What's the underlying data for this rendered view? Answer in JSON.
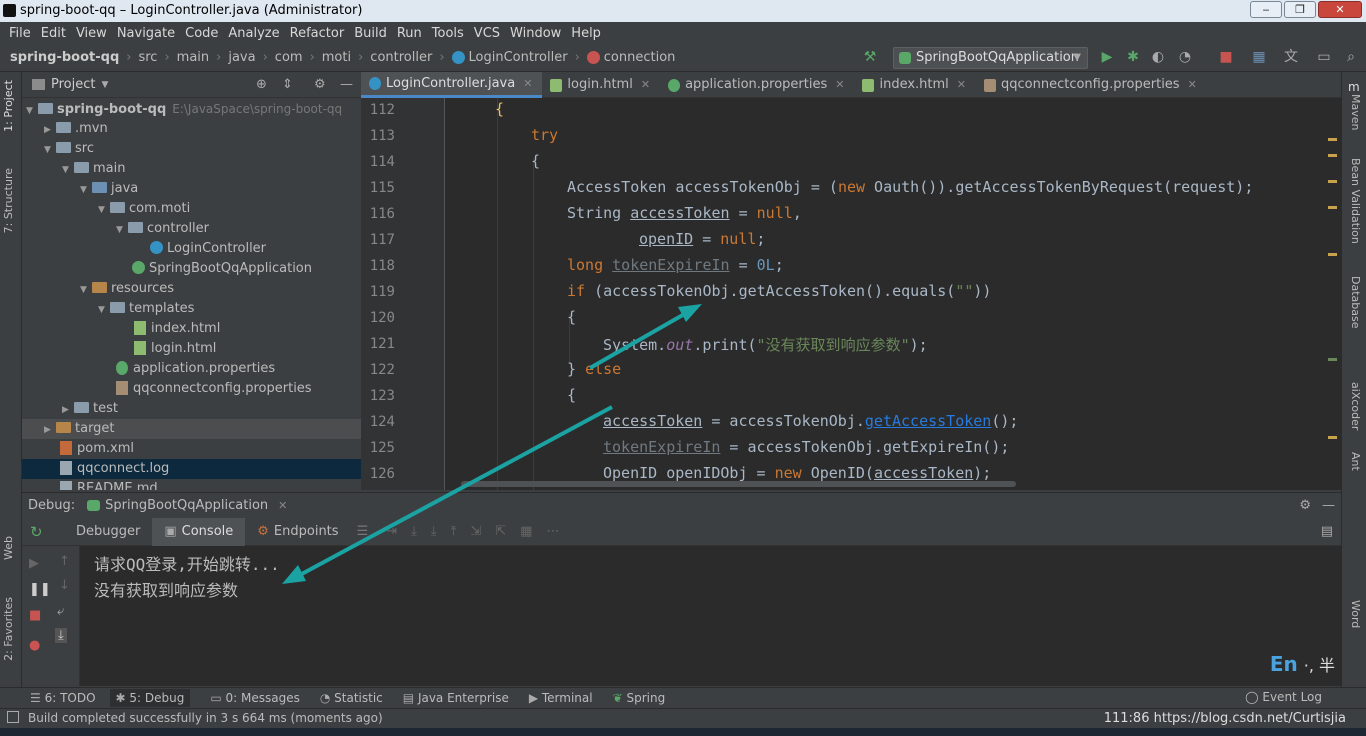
{
  "window": {
    "title": "spring-boot-qq – LoginController.java (Administrator)"
  },
  "menu": [
    "File",
    "Edit",
    "View",
    "Navigate",
    "Code",
    "Analyze",
    "Refactor",
    "Build",
    "Run",
    "Tools",
    "VCS",
    "Window",
    "Help"
  ],
  "breadcrumb": [
    "spring-boot-qq",
    "src",
    "main",
    "java",
    "com",
    "moti",
    "controller",
    "LoginController",
    "connection"
  ],
  "run_config": "SpringBootQqApplication",
  "left_tabs": {
    "project": "1: Project",
    "structure": "7: Structure",
    "web": "Web",
    "favorites": "2: Favorites"
  },
  "right_tabs": {
    "maven": "Maven",
    "bean": "Bean Validation",
    "database": "Database",
    "aixcoder": "aiXcoder",
    "ant": "Ant",
    "word": "Word"
  },
  "project": {
    "header": "Project",
    "tree": [
      {
        "label": "spring-boot-qq",
        "path": "E:\\JavaSpace\\spring-boot-qq"
      },
      {
        "label": ".mvn"
      },
      {
        "label": "src"
      },
      {
        "label": "main"
      },
      {
        "label": "java"
      },
      {
        "label": "com.moti"
      },
      {
        "label": "controller"
      },
      {
        "label": "LoginController"
      },
      {
        "label": "SpringBootQqApplication"
      },
      {
        "label": "resources"
      },
      {
        "label": "templates"
      },
      {
        "label": "index.html"
      },
      {
        "label": "login.html"
      },
      {
        "label": "application.properties"
      },
      {
        "label": "qqconnectconfig.properties"
      },
      {
        "label": "test"
      },
      {
        "label": "target"
      },
      {
        "label": "pom.xml"
      },
      {
        "label": "qqconnect.log"
      },
      {
        "label": "README.md"
      }
    ]
  },
  "editor_tabs": [
    "LoginController.java",
    "login.html",
    "application.properties",
    "index.html",
    "qqconnectconfig.properties"
  ],
  "line_numbers": [
    "112",
    "113",
    "114",
    "115",
    "116",
    "117",
    "118",
    "119",
    "120",
    "121",
    "122",
    "123",
    "124",
    "125",
    "126"
  ],
  "code": {
    "l112": "{",
    "l113": "try",
    "l114": "{",
    "l115a": "AccessToken accessTokenObj = (",
    "l115b": "new",
    "l115c": " Oauth()).getAccessTokenByRequest(request);",
    "l116a": "String ",
    "l116b": "accessToken",
    "l116c": " = ",
    "l116d": "null",
    "l116e": ",",
    "l117a": "openID",
    "l117b": " = ",
    "l117c": "null",
    "l117d": ";",
    "l118a": "long ",
    "l118b": "tokenExpireIn",
    "l118c": " = ",
    "l118d": "0L",
    "l118e": ";",
    "l119a": "if",
    "l119b": " (accessTokenObj.getAccessToken().equals(",
    "l119c": "\"\"",
    "l119d": "))",
    "l120": "{",
    "l121a": "System.",
    "l121b": "out",
    "l121c": ".print(",
    "l121d": "\"没有获取到响应参数\"",
    "l121e": ");",
    "l122a": "} ",
    "l122b": "else",
    "l123": "{",
    "l124a": "accessToken",
    "l124b": " = accessTokenObj.",
    "l124c": "getAccessToken",
    "l124d": "();",
    "l125a": "tokenExpireIn",
    "l125b": " = accessTokenObj.getExpireIn();",
    "l126a": "OpenID openIDObj = ",
    "l126b": "new",
    "l126c": " OpenID(",
    "l126d": "accessToken",
    "l126e": ");"
  },
  "debug": {
    "label": "Debug:",
    "config": "SpringBootQqApplication",
    "tabs": [
      "Debugger",
      "Console",
      "Endpoints"
    ]
  },
  "console": [
    "请求QQ登录,开始跳转...",
    "没有获取到响应参数"
  ],
  "ime": {
    "lang": "En",
    "mode": "·, 半"
  },
  "toolwindows": [
    "6: TODO",
    "5: Debug",
    "0: Messages",
    "Statistic",
    "Java Enterprise",
    "Terminal",
    "Spring"
  ],
  "event_log": "Event Log",
  "status": {
    "message": "Build completed successfully in 3 s 664 ms (moments ago)",
    "right": "111:86  https://blog.csdn.net/Curtisjia"
  }
}
